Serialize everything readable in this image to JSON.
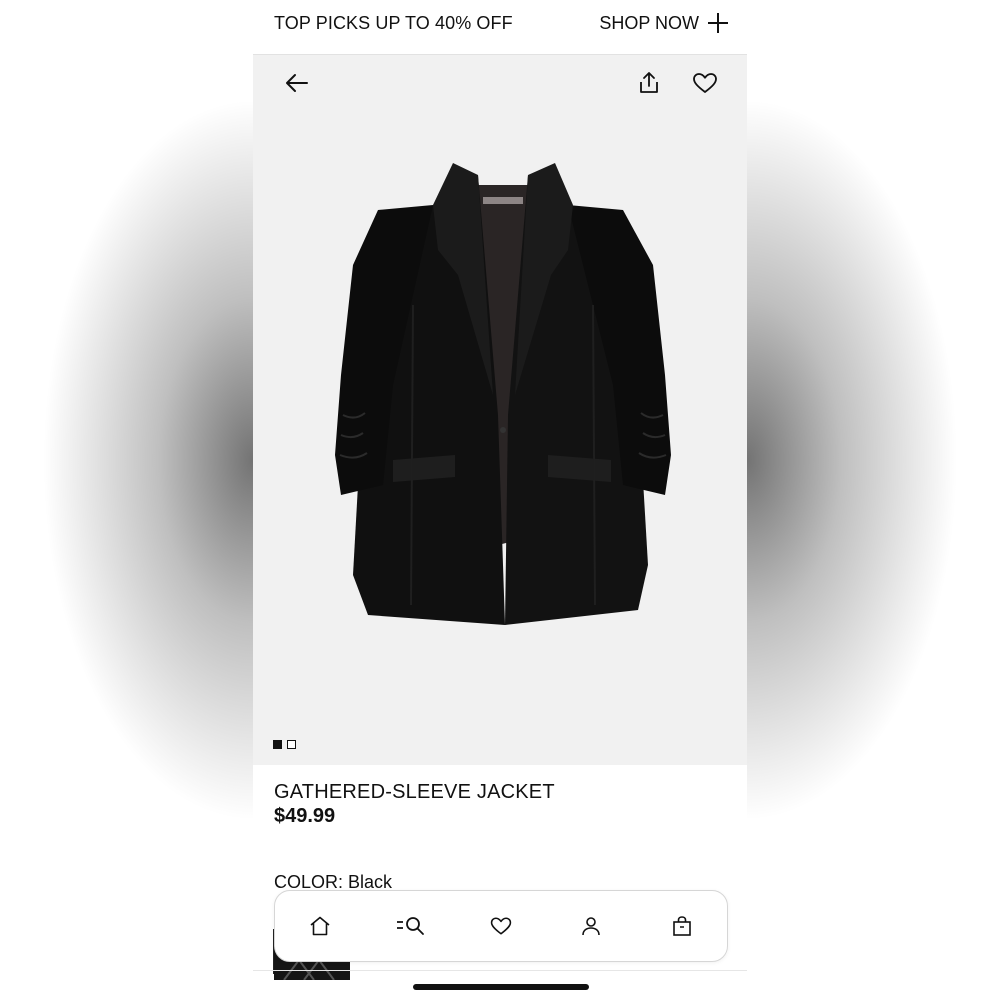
{
  "promo": {
    "text": "TOP PICKS UP TO 40% OFF",
    "cta": "SHOP NOW"
  },
  "product": {
    "name": "GATHERED-SLEEVE JACKET",
    "price": "$49.99",
    "color_label": "COLOR:",
    "color_value": "Black"
  },
  "gallery": {
    "image_count": 2,
    "active_index": 0
  },
  "icons": {
    "back": "arrow-left-icon",
    "share": "share-icon",
    "favorite": "heart-icon",
    "plus": "plus-icon"
  },
  "tabbar": {
    "items": [
      "home-icon",
      "search-icon",
      "heart-icon",
      "account-icon",
      "bag-icon"
    ]
  },
  "colors": {
    "accent": "#111111",
    "hero_bg": "#f1f1f1"
  }
}
